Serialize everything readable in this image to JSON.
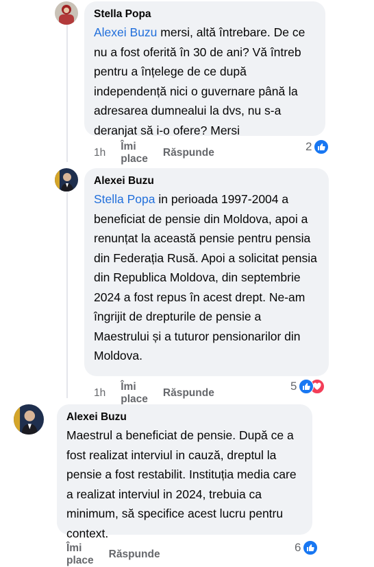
{
  "comments": [
    {
      "author": "Stella Popa",
      "mention": "Alexei Buzu",
      "text": " mersi, altă întrebare. De ce nu a fost oferită în 30 de ani? Vă întreb pentru a înțelege de ce după independență nici o guvernare până la adresarea dumnealui la dvs, nu s-a deranjat să i-o ofere? Mersi",
      "time": "1h",
      "like_label": "Îmi place",
      "reply_label": "Răspunde",
      "reaction_count": "2",
      "reactions": [
        "like-icon"
      ]
    },
    {
      "author": "Alexei Buzu",
      "mention": "Stella Popa",
      "text": " in perioada 1997-2004 a beneficiat de pensie din Moldova, apoi a renunțat la această pensie pentru pensia din Federația Rusă. Apoi a solicitat pensia din Republica Moldova, din septembrie 2024 a fost repus în acest drept. Ne-am îngrijit de drepturile de pensie a Maestrului și a tuturor pensionarilor din Moldova.",
      "time": "1h",
      "like_label": "Îmi place",
      "reply_label": "Răspunde",
      "reaction_count": "5",
      "reactions": [
        "like-icon",
        "love-icon"
      ]
    },
    {
      "author": "Alexei Buzu",
      "text": "Maestrul a beneficiat de pensie. După ce a fost realizat interviul in cauză, dreptul la pensie a fost restabilit. Instituția media care a realizat interviul in 2024, trebuia ca minimum, să specifice acest lucru pentru context.",
      "like_label": "Îmi place",
      "reply_label": "Răspunde",
      "reaction_count": "6",
      "reactions": [
        "like-icon"
      ]
    }
  ],
  "colors": {
    "bubble": "#f0f2f5",
    "mention": "#216fdb",
    "meta": "#65676b",
    "like": "#1877f2",
    "love": "#f33e58"
  }
}
